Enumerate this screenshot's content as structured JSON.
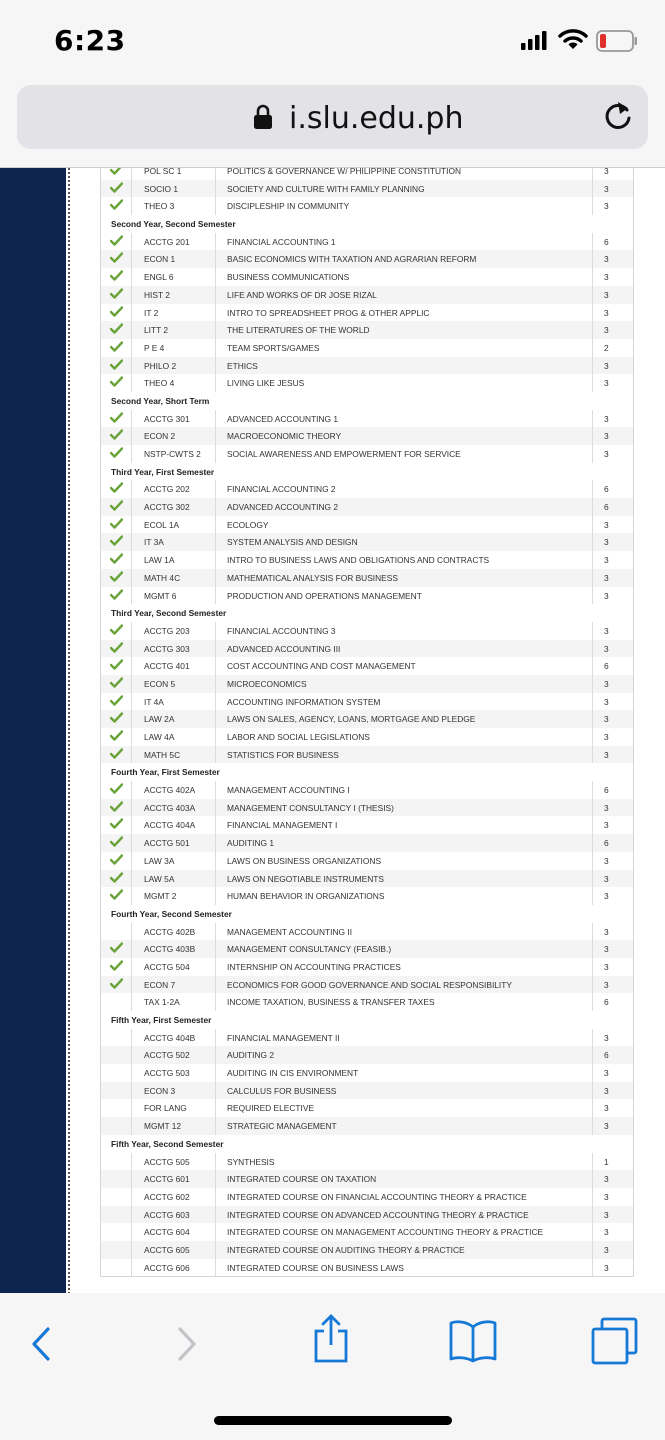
{
  "status_bar": {
    "time": "6:23"
  },
  "browser": {
    "url": "i.slu.edu.ph"
  },
  "colors": {
    "accent": "#1679d6",
    "band": "#0e2550",
    "check": "#6aa33a",
    "battery_low": "#e0322c"
  },
  "rows": [
    {
      "type": "course",
      "checked": true,
      "code": "POL SC 1",
      "title": "POLITICS & GOVERNANCE W/ PHILIPPINE CONSTITUTION",
      "units": "3"
    },
    {
      "type": "course",
      "checked": true,
      "code": "SOCIO 1",
      "title": "SOCIETY AND CULTURE WITH FAMILY PLANNING",
      "units": "3"
    },
    {
      "type": "course",
      "checked": true,
      "code": "THEO 3",
      "title": "DISCIPLESHIP IN COMMUNITY",
      "units": "3"
    },
    {
      "type": "header",
      "label": "Second Year, Second Semester"
    },
    {
      "type": "course",
      "checked": true,
      "code": "ACCTG 201",
      "title": "FINANCIAL ACCOUNTING 1",
      "units": "6"
    },
    {
      "type": "course",
      "checked": true,
      "code": "ECON 1",
      "title": "BASIC ECONOMICS WITH TAXATION AND AGRARIAN REFORM",
      "units": "3"
    },
    {
      "type": "course",
      "checked": true,
      "code": "ENGL 6",
      "title": "BUSINESS COMMUNICATIONS",
      "units": "3"
    },
    {
      "type": "course",
      "checked": true,
      "code": "HIST 2",
      "title": "LIFE AND WORKS OF DR JOSE RIZAL",
      "units": "3"
    },
    {
      "type": "course",
      "checked": true,
      "code": "IT 2",
      "title": "INTRO TO SPREADSHEET PROG & OTHER APPLIC",
      "units": "3"
    },
    {
      "type": "course",
      "checked": true,
      "code": "LITT 2",
      "title": "THE LITERATURES OF THE WORLD",
      "units": "3"
    },
    {
      "type": "course",
      "checked": true,
      "code": "P E 4",
      "title": "TEAM SPORTS/GAMES",
      "units": "2"
    },
    {
      "type": "course",
      "checked": true,
      "code": "PHILO 2",
      "title": "ETHICS",
      "units": "3"
    },
    {
      "type": "course",
      "checked": true,
      "code": "THEO 4",
      "title": "LIVING LIKE JESUS",
      "units": "3"
    },
    {
      "type": "header",
      "label": "Second Year, Short Term"
    },
    {
      "type": "course",
      "checked": true,
      "code": "ACCTG 301",
      "title": "ADVANCED ACCOUNTING 1",
      "units": "3"
    },
    {
      "type": "course",
      "checked": true,
      "code": "ECON 2",
      "title": "MACROECONOMIC THEORY",
      "units": "3"
    },
    {
      "type": "course",
      "checked": true,
      "code": "NSTP-CWTS 2",
      "title": "SOCIAL AWARENESS AND EMPOWERMENT FOR SERVICE",
      "units": "3"
    },
    {
      "type": "header",
      "label": "Third Year, First Semester"
    },
    {
      "type": "course",
      "checked": true,
      "code": "ACCTG 202",
      "title": "FINANCIAL ACCOUNTING 2",
      "units": "6"
    },
    {
      "type": "course",
      "checked": true,
      "code": "ACCTG 302",
      "title": "ADVANCED ACCOUNTING 2",
      "units": "6"
    },
    {
      "type": "course",
      "checked": true,
      "code": "ECOL 1A",
      "title": "ECOLOGY",
      "units": "3"
    },
    {
      "type": "course",
      "checked": true,
      "code": "IT 3A",
      "title": "SYSTEM ANALYSIS AND DESIGN",
      "units": "3"
    },
    {
      "type": "course",
      "checked": true,
      "code": "LAW 1A",
      "title": "INTRO TO BUSINESS LAWS AND OBLIGATIONS AND CONTRACTS",
      "units": "3"
    },
    {
      "type": "course",
      "checked": true,
      "code": "MATH 4C",
      "title": "MATHEMATICAL ANALYSIS FOR BUSINESS",
      "units": "3"
    },
    {
      "type": "course",
      "checked": true,
      "code": "MGMT 6",
      "title": "PRODUCTION AND OPERATIONS MANAGEMENT",
      "units": "3"
    },
    {
      "type": "header",
      "label": "Third Year, Second Semester"
    },
    {
      "type": "course",
      "checked": true,
      "code": "ACCTG 203",
      "title": "FINANCIAL ACCOUNTING 3",
      "units": "3"
    },
    {
      "type": "course",
      "checked": true,
      "code": "ACCTG 303",
      "title": "ADVANCED ACCOUNTING III",
      "units": "3"
    },
    {
      "type": "course",
      "checked": true,
      "code": "ACCTG 401",
      "title": "COST ACCOUNTING AND COST MANAGEMENT",
      "units": "6"
    },
    {
      "type": "course",
      "checked": true,
      "code": "ECON 5",
      "title": "MICROECONOMICS",
      "units": "3"
    },
    {
      "type": "course",
      "checked": true,
      "code": "IT 4A",
      "title": "ACCOUNTING INFORMATION SYSTEM",
      "units": "3"
    },
    {
      "type": "course",
      "checked": true,
      "code": "LAW 2A",
      "title": "LAWS ON SALES, AGENCY, LOANS, MORTGAGE AND PLEDGE",
      "units": "3"
    },
    {
      "type": "course",
      "checked": true,
      "code": "LAW 4A",
      "title": "LABOR AND SOCIAL LEGISLATIONS",
      "units": "3"
    },
    {
      "type": "course",
      "checked": true,
      "code": "MATH 5C",
      "title": "STATISTICS FOR BUSINESS",
      "units": "3"
    },
    {
      "type": "header",
      "label": "Fourth Year, First Semester"
    },
    {
      "type": "course",
      "checked": true,
      "code": "ACCTG 402A",
      "title": "MANAGEMENT ACCOUNTING I",
      "units": "6"
    },
    {
      "type": "course",
      "checked": true,
      "code": "ACCTG 403A",
      "title": "MANAGEMENT CONSULTANCY I (THESIS)",
      "units": "3"
    },
    {
      "type": "course",
      "checked": true,
      "code": "ACCTG 404A",
      "title": "FINANCIAL MANAGEMENT I",
      "units": "3"
    },
    {
      "type": "course",
      "checked": true,
      "code": "ACCTG 501",
      "title": "AUDITING 1",
      "units": "6"
    },
    {
      "type": "course",
      "checked": true,
      "code": "LAW 3A",
      "title": "LAWS ON BUSINESS ORGANIZATIONS",
      "units": "3"
    },
    {
      "type": "course",
      "checked": true,
      "code": "LAW 5A",
      "title": "LAWS ON NEGOTIABLE INSTRUMENTS",
      "units": "3"
    },
    {
      "type": "course",
      "checked": true,
      "code": "MGMT 2",
      "title": "HUMAN BEHAVIOR IN ORGANIZATIONS",
      "units": "3"
    },
    {
      "type": "header",
      "label": "Fourth Year, Second Semester"
    },
    {
      "type": "course",
      "checked": false,
      "code": "ACCTG 402B",
      "title": "MANAGEMENT ACCOUNTING II",
      "units": "3"
    },
    {
      "type": "course",
      "checked": true,
      "code": "ACCTG 403B",
      "title": "MANAGEMENT CONSULTANCY (FEASIB.)",
      "units": "3"
    },
    {
      "type": "course",
      "checked": true,
      "code": "ACCTG 504",
      "title": "INTERNSHIP ON ACCOUNTING PRACTICES",
      "units": "3"
    },
    {
      "type": "course",
      "checked": true,
      "code": "ECON 7",
      "title": "ECONOMICS FOR GOOD GOVERNANCE AND SOCIAL RESPONSIBILITY",
      "units": "3"
    },
    {
      "type": "course",
      "checked": false,
      "code": "TAX 1-2A",
      "title": "INCOME TAXATION, BUSINESS & TRANSFER TAXES",
      "units": "6"
    },
    {
      "type": "header",
      "label": "Fifth Year, First Semester"
    },
    {
      "type": "course",
      "checked": false,
      "code": "ACCTG 404B",
      "title": "FINANCIAL MANAGEMENT II",
      "units": "3"
    },
    {
      "type": "course",
      "checked": false,
      "code": "ACCTG 502",
      "title": "AUDITING 2",
      "units": "6"
    },
    {
      "type": "course",
      "checked": false,
      "code": "ACCTG 503",
      "title": "AUDITING IN CIS ENVIRONMENT",
      "units": "3"
    },
    {
      "type": "course",
      "checked": false,
      "code": "ECON 3",
      "title": "CALCULUS FOR BUSINESS",
      "units": "3"
    },
    {
      "type": "course",
      "checked": false,
      "code": "FOR LANG",
      "title": "REQUIRED ELECTIVE",
      "units": "3"
    },
    {
      "type": "course",
      "checked": false,
      "code": "MGMT 12",
      "title": "STRATEGIC MANAGEMENT",
      "units": "3"
    },
    {
      "type": "header",
      "label": "Fifth Year, Second Semester"
    },
    {
      "type": "course",
      "checked": false,
      "code": "ACCTG 505",
      "title": "SYNTHESIS",
      "units": "1"
    },
    {
      "type": "course",
      "checked": false,
      "code": "ACCTG 601",
      "title": "INTEGRATED COURSE ON TAXATION",
      "units": "3"
    },
    {
      "type": "course",
      "checked": false,
      "code": "ACCTG 602",
      "title": "INTEGRATED COURSE ON FINANCIAL ACCOUNTING THEORY & PRACTICE",
      "units": "3"
    },
    {
      "type": "course",
      "checked": false,
      "code": "ACCTG 603",
      "title": "INTEGRATED COURSE ON ADVANCED ACCOUNTING THEORY & PRACTICE",
      "units": "3"
    },
    {
      "type": "course",
      "checked": false,
      "code": "ACCTG 604",
      "title": "INTEGRATED COURSE ON MANAGEMENT ACCOUNTING THEORY & PRACTICE",
      "units": "3"
    },
    {
      "type": "course",
      "checked": false,
      "code": "ACCTG 605",
      "title": "INTEGRATED COURSE ON AUDITING THEORY & PRACTICE",
      "units": "3"
    },
    {
      "type": "course",
      "checked": false,
      "code": "ACCTG 606",
      "title": "INTEGRATED COURSE ON BUSINESS LAWS",
      "units": "3"
    }
  ]
}
